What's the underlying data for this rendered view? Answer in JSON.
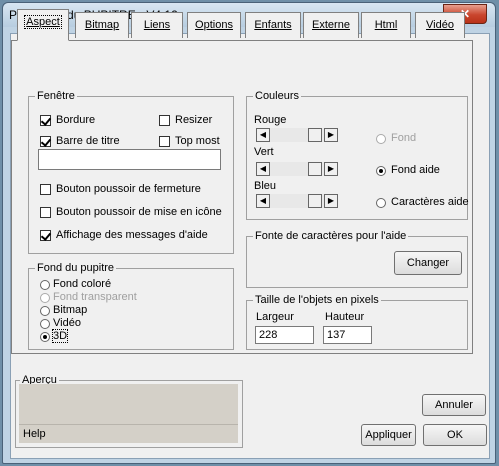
{
  "window": {
    "title": "Propriétés du PUPITRE - V4.12",
    "close_glyph": "✕"
  },
  "tabs": [
    {
      "label": "Aspect",
      "active": true
    },
    {
      "label": "Bitmap"
    },
    {
      "label": "Liens"
    },
    {
      "label": "Options"
    },
    {
      "label": "Enfants"
    },
    {
      "label": "Externe"
    },
    {
      "label": "Html"
    },
    {
      "label": "Vidéo"
    }
  ],
  "fenetre": {
    "label": "Fenêtre",
    "bordure": {
      "label": "Bordure",
      "checked": true
    },
    "resizer": {
      "label": "Resizer",
      "checked": false
    },
    "barre_titre": {
      "label": "Barre de titre",
      "checked": true
    },
    "top_most": {
      "label": "Top most",
      "checked": false
    },
    "title_value": "",
    "bouton_fermeture": {
      "label": "Bouton poussoir de fermeture",
      "checked": false
    },
    "bouton_icone": {
      "label": "Bouton poussoir de mise en icône",
      "checked": false
    },
    "affichage_aide": {
      "label": "Affichage des messages d'aide",
      "checked": true
    }
  },
  "fond": {
    "label": "Fond du pupitre",
    "options": [
      {
        "label": "Fond coloré",
        "enabled": true,
        "selected": false
      },
      {
        "label": "Fond transparent",
        "enabled": false,
        "selected": false
      },
      {
        "label": "Bitmap",
        "enabled": true,
        "selected": false
      },
      {
        "label": "Vidéo",
        "enabled": true,
        "selected": false
      },
      {
        "label": "3D",
        "enabled": true,
        "selected": true
      }
    ]
  },
  "couleurs": {
    "label": "Couleurs",
    "rouge": "Rouge",
    "vert": "Vert",
    "bleu": "Bleu",
    "fond": {
      "label": "Fond",
      "enabled": false,
      "selected": false
    },
    "fond_aide": {
      "label": "Fond aide",
      "enabled": true,
      "selected": true
    },
    "caracteres_aide": {
      "label": "Caractères aide",
      "enabled": true,
      "selected": false
    }
  },
  "police": {
    "label": "Fonte de caractères pour l'aide",
    "button": "Changer"
  },
  "taille": {
    "label": "Taille de l'objets en pixels",
    "largeur_label": "Largeur",
    "hauteur_label": "Hauteur",
    "largeur": "228",
    "hauteur": "137"
  },
  "apercu": {
    "label": "Aperçu",
    "help": "Help"
  },
  "buttons": {
    "annuler": "Annuler",
    "appliquer": "Appliquer",
    "ok": "OK"
  }
}
